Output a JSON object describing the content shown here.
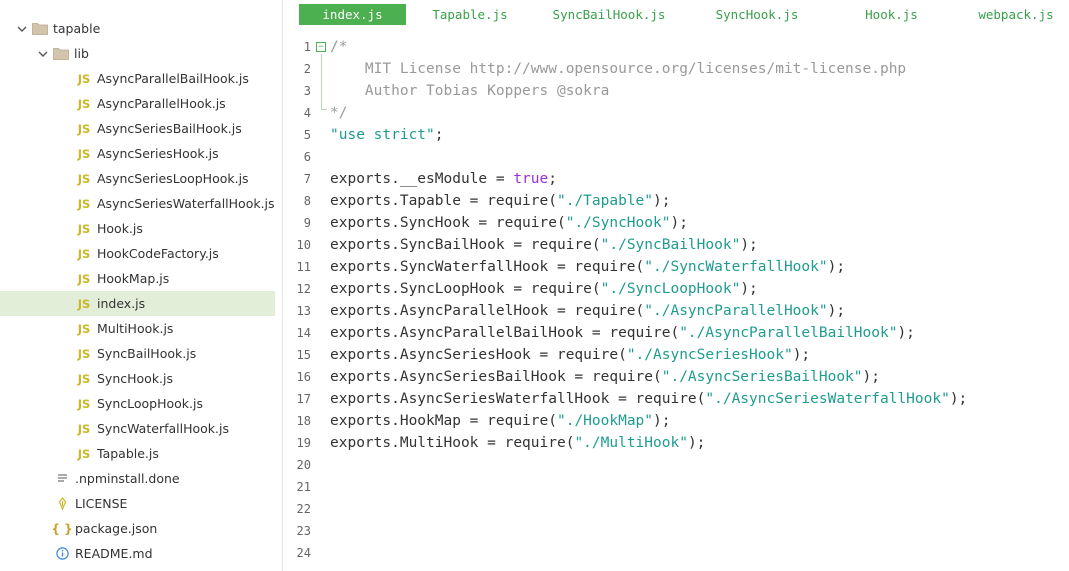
{
  "sidebar": {
    "root": {
      "label": "tapable"
    },
    "lib": {
      "label": "lib"
    },
    "lib_files": [
      {
        "name": "AsyncParallelBailHook.js",
        "icon": "JS"
      },
      {
        "name": "AsyncParallelHook.js",
        "icon": "JS"
      },
      {
        "name": "AsyncSeriesBailHook.js",
        "icon": "JS"
      },
      {
        "name": "AsyncSeriesHook.js",
        "icon": "JS"
      },
      {
        "name": "AsyncSeriesLoopHook.js",
        "icon": "JS"
      },
      {
        "name": "AsyncSeriesWaterfallHook.js",
        "icon": "JS"
      },
      {
        "name": "Hook.js",
        "icon": "JS"
      },
      {
        "name": "HookCodeFactory.js",
        "icon": "JS"
      },
      {
        "name": "HookMap.js",
        "icon": "JS"
      },
      {
        "name": "index.js",
        "icon": "JS"
      },
      {
        "name": "MultiHook.js",
        "icon": "JS"
      },
      {
        "name": "SyncBailHook.js",
        "icon": "JS"
      },
      {
        "name": "SyncHook.js",
        "icon": "JS"
      },
      {
        "name": "SyncLoopHook.js",
        "icon": "JS"
      },
      {
        "name": "SyncWaterfallHook.js",
        "icon": "JS"
      },
      {
        "name": "Tapable.js",
        "icon": "JS"
      }
    ],
    "root_files": [
      {
        "name": ".npminstall.done",
        "icon": "doc-icon"
      },
      {
        "name": "LICENSE",
        "icon": "license-icon"
      },
      {
        "name": "package.json",
        "icon": "{ }"
      },
      {
        "name": "README.md",
        "icon": "info-icon"
      }
    ],
    "selected": "index.js",
    "colors": {
      "selected_bg": "#e3eed9",
      "js_icon": "#c9b92a",
      "folder": "#c9b9a0"
    }
  },
  "tabs": [
    {
      "label": "index.js",
      "active": true
    },
    {
      "label": "Tapable.js",
      "active": false
    },
    {
      "label": "SyncBailHook.js",
      "active": false
    },
    {
      "label": "SyncHook.js",
      "active": false
    },
    {
      "label": "Hook.js",
      "active": false
    },
    {
      "label": "webpack.js",
      "active": false
    }
  ],
  "editor": {
    "line_numbers": [
      "1",
      "2",
      "3",
      "4",
      "5",
      "6",
      "7",
      "8",
      "9",
      "10",
      "11",
      "12",
      "13",
      "14",
      "15",
      "16",
      "17",
      "18",
      "19",
      "20",
      "21",
      "22",
      "23",
      "24"
    ],
    "fold_marker": "−",
    "lines": [
      [
        {
          "t": "/*",
          "c": "cm"
        }
      ],
      [
        {
          "t": "    MIT License http://www.opensource.org/licenses/mit-license.php",
          "c": "cm"
        }
      ],
      [
        {
          "t": "    Author Tobias Koppers @sokra",
          "c": "cm"
        }
      ],
      [
        {
          "t": "*/",
          "c": "cm"
        }
      ],
      [
        {
          "t": "\"use strict\"",
          "c": "str"
        },
        {
          "t": ";",
          "c": "plain"
        }
      ],
      [],
      [
        {
          "t": "exports.__esModule = ",
          "c": "plain"
        },
        {
          "t": "true",
          "c": "kw"
        },
        {
          "t": ";",
          "c": "plain"
        }
      ],
      [
        {
          "t": "exports.Tapable = require(",
          "c": "plain"
        },
        {
          "t": "\"./Tapable\"",
          "c": "str"
        },
        {
          "t": ");",
          "c": "plain"
        }
      ],
      [
        {
          "t": "exports.SyncHook = require(",
          "c": "plain"
        },
        {
          "t": "\"./SyncHook\"",
          "c": "str"
        },
        {
          "t": ");",
          "c": "plain"
        }
      ],
      [
        {
          "t": "exports.SyncBailHook = require(",
          "c": "plain"
        },
        {
          "t": "\"./SyncBailHook\"",
          "c": "str"
        },
        {
          "t": ");",
          "c": "plain"
        }
      ],
      [
        {
          "t": "exports.SyncWaterfallHook = require(",
          "c": "plain"
        },
        {
          "t": "\"./SyncWaterfallHook\"",
          "c": "str"
        },
        {
          "t": ");",
          "c": "plain"
        }
      ],
      [
        {
          "t": "exports.SyncLoopHook = require(",
          "c": "plain"
        },
        {
          "t": "\"./SyncLoopHook\"",
          "c": "str"
        },
        {
          "t": ");",
          "c": "plain"
        }
      ],
      [
        {
          "t": "exports.AsyncParallelHook = require(",
          "c": "plain"
        },
        {
          "t": "\"./AsyncParallelHook\"",
          "c": "str"
        },
        {
          "t": ");",
          "c": "plain"
        }
      ],
      [
        {
          "t": "exports.AsyncParallelBailHook = require(",
          "c": "plain"
        },
        {
          "t": "\"./AsyncParallelBailHook\"",
          "c": "str"
        },
        {
          "t": ");",
          "c": "plain"
        }
      ],
      [
        {
          "t": "exports.AsyncSeriesHook = require(",
          "c": "plain"
        },
        {
          "t": "\"./AsyncSeriesHook\"",
          "c": "str"
        },
        {
          "t": ");",
          "c": "plain"
        }
      ],
      [
        {
          "t": "exports.AsyncSeriesBailHook = require(",
          "c": "plain"
        },
        {
          "t": "\"./AsyncSeriesBailHook\"",
          "c": "str"
        },
        {
          "t": ");",
          "c": "plain"
        }
      ],
      [
        {
          "t": "exports.AsyncSeriesWaterfallHook = require(",
          "c": "plain"
        },
        {
          "t": "\"./AsyncSeriesWaterfallHook\"",
          "c": "str"
        },
        {
          "t": ");",
          "c": "plain"
        }
      ],
      [
        {
          "t": "exports.HookMap = require(",
          "c": "plain"
        },
        {
          "t": "\"./HookMap\"",
          "c": "str"
        },
        {
          "t": ");",
          "c": "plain"
        }
      ],
      [
        {
          "t": "exports.MultiHook = require(",
          "c": "plain"
        },
        {
          "t": "\"./MultiHook\"",
          "c": "str"
        },
        {
          "t": ");",
          "c": "plain"
        }
      ],
      [],
      [],
      [],
      [],
      []
    ],
    "colors": {
      "comment": "#999999",
      "string": "#1f9c8f",
      "keyword": "#9a2fd6",
      "text": "#333333"
    }
  }
}
